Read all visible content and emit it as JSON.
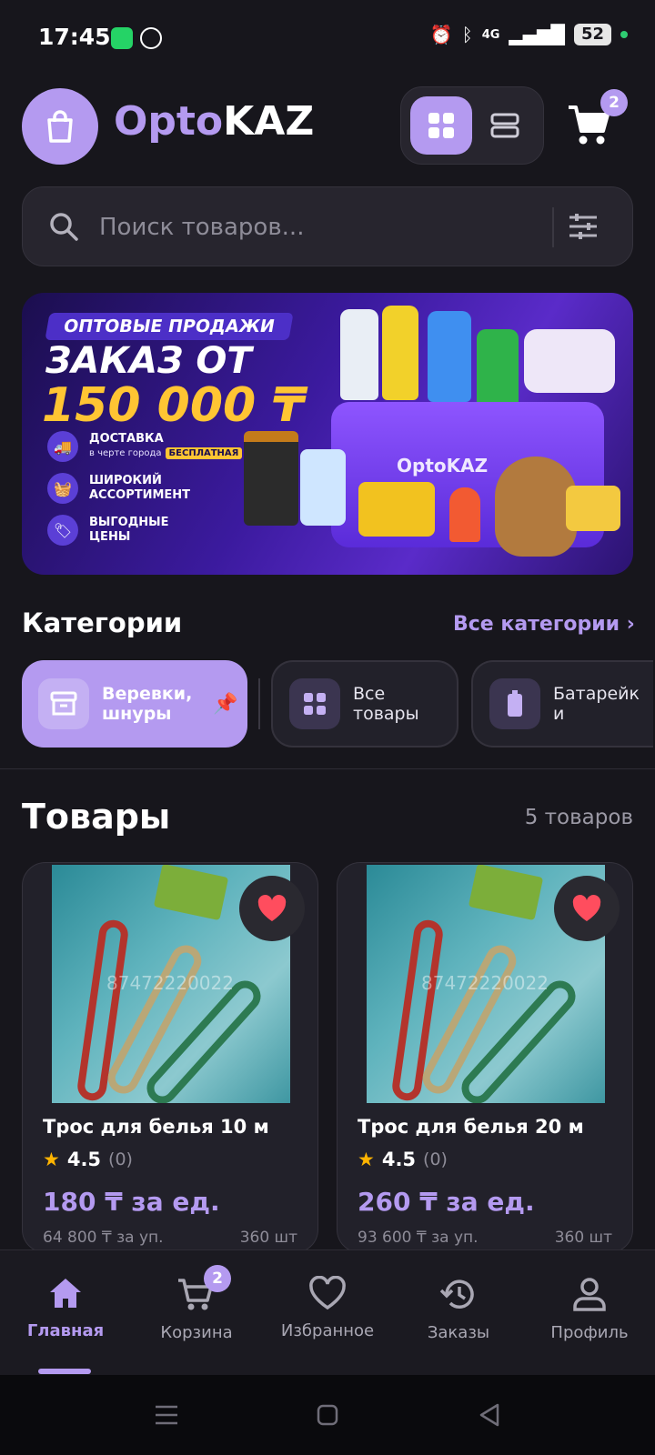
{
  "status_bar": {
    "time": "17:45",
    "network": "4G",
    "battery": "52"
  },
  "header": {
    "brand_prefix": "Opto",
    "brand_suffix": "KAZ",
    "cart_count": "2"
  },
  "search": {
    "placeholder": "Поиск товаров..."
  },
  "banner": {
    "pill": "ОПТОВЫЕ ПРОДАЖИ",
    "line1": "ЗАКАЗ ОТ",
    "line2": "150 000 ₸",
    "features": [
      {
        "title": "ДОСТАВКА",
        "sub": "в черте города",
        "tag": "БЕСПЛАТНАЯ"
      },
      {
        "title": "ШИРОКИЙ АССОРТИМЕНТ"
      },
      {
        "title": "ВЫГОДНЫЕ ЦЕНЫ"
      }
    ],
    "basket_label": "OptoKAZ"
  },
  "categories": {
    "title": "Категории",
    "all_label": "Все категории",
    "items": [
      {
        "label": "Веревки, шнуры",
        "active": true
      },
      {
        "label": "Все товары"
      },
      {
        "label": "Батарейки"
      }
    ]
  },
  "products": {
    "title": "Товары",
    "count": "5 товаров",
    "items": [
      {
        "name": "Трос для белья 10 м",
        "rating": "4.5",
        "reviews": "(0)",
        "price": "180 ₸ за ед.",
        "pack": "64 800 ₸ за уп.",
        "qty": "360 шт",
        "watermark": "87472220022"
      },
      {
        "name": "Трос для белья 20 м",
        "rating": "4.5",
        "reviews": "(0)",
        "price": "260 ₸ за ед.",
        "pack": "93 600 ₸ за уп.",
        "qty": "360 шт",
        "watermark": "87472220022"
      }
    ]
  },
  "bottom_nav": {
    "items": [
      {
        "label": "Главная",
        "active": true
      },
      {
        "label": "Корзина",
        "badge": "2"
      },
      {
        "label": "Избранное"
      },
      {
        "label": "Заказы"
      },
      {
        "label": "Профиль"
      }
    ]
  },
  "colors": {
    "accent": "#b49af0",
    "background": "#17161c",
    "surface": "#22212a",
    "favorite": "#ff4d5e",
    "star": "#ffb400"
  }
}
